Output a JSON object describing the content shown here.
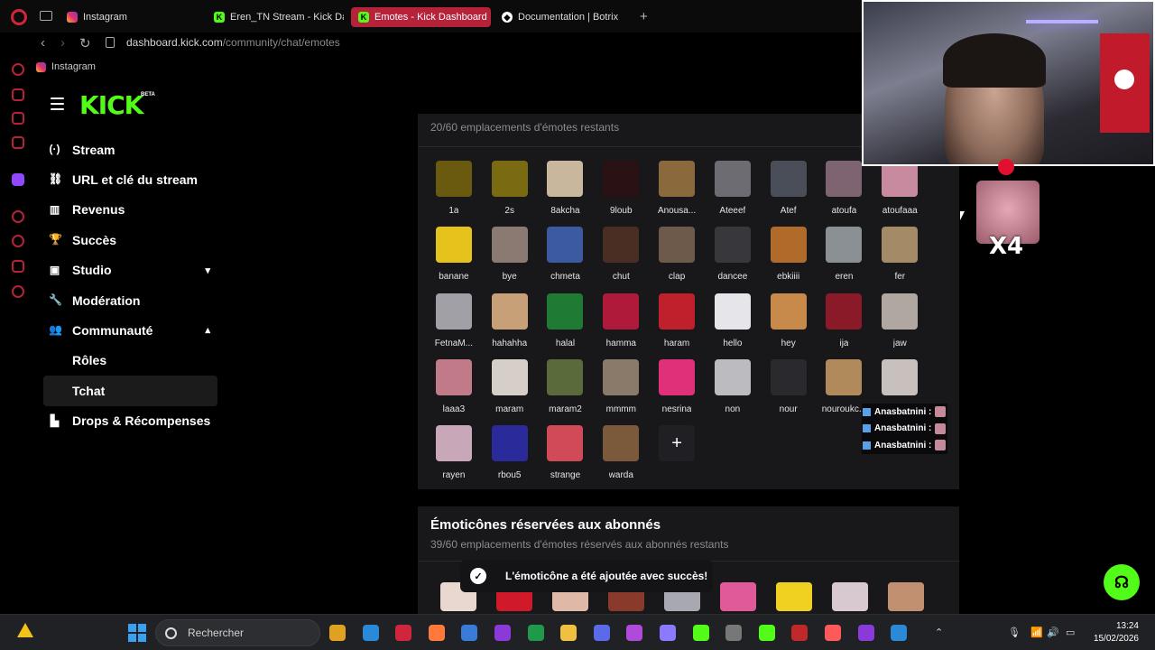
{
  "browser": {
    "tabs": [
      {
        "label": "Instagram",
        "icon": "instagram-icon",
        "fav": "insta"
      },
      {
        "label": "Eren_TN Stream - Kick Da",
        "icon": "kick-icon",
        "fav": "kick"
      },
      {
        "label": "Emotes - Kick Dashboard",
        "icon": "kick-icon",
        "fav": "kick",
        "active": true
      },
      {
        "label": "Documentation | Botrix",
        "icon": "botrix-icon",
        "fav": "botrix"
      }
    ],
    "url_host": "dashboard.kick.com",
    "url_path": "/community/chat/emotes",
    "bookmark": "Instagram"
  },
  "app": {
    "logo": "KICK",
    "beta": "BETA",
    "nav": [
      {
        "label": "Stream",
        "icon": "broadcast-icon",
        "glyph": "(·)"
      },
      {
        "label": "URL et clé du stream",
        "icon": "link-icon",
        "glyph": "⛓"
      },
      {
        "label": "Revenus",
        "icon": "chart-icon",
        "glyph": "▥"
      },
      {
        "label": "Succès",
        "icon": "trophy-icon",
        "glyph": "🏆"
      },
      {
        "label": "Studio",
        "icon": "studio-icon",
        "glyph": "▣",
        "chevron": "▾"
      },
      {
        "label": "Modération",
        "icon": "wrench-icon",
        "glyph": "🔧"
      },
      {
        "label": "Communauté",
        "icon": "community-icon",
        "glyph": "👥",
        "chevron": "▴"
      },
      {
        "label": "Rôles",
        "sub": true
      },
      {
        "label": "Tchat",
        "sub": true,
        "active": true
      },
      {
        "label": "Drops & Récompenses",
        "icon": "drops-icon",
        "glyph": "▙"
      }
    ]
  },
  "emotes": {
    "slots_text": "20/60 emplacements d'émotes restants",
    "items": [
      {
        "name": "1a",
        "color": "#6a5a10"
      },
      {
        "name": "2s",
        "color": "#7a6a12"
      },
      {
        "name": "8akcha",
        "color": "#c9b79d"
      },
      {
        "name": "9loub",
        "color": "#2a1214"
      },
      {
        "name": "Anousa...",
        "color": "#8a6a3c"
      },
      {
        "name": "Ateeef",
        "color": "#6c6c72"
      },
      {
        "name": "Atef",
        "color": "#4a4e58"
      },
      {
        "name": "atoufa",
        "color": "#7d6470"
      },
      {
        "name": "atoufaaa",
        "color": "#c78a9f"
      },
      {
        "name": "banane",
        "color": "#e6c21c"
      },
      {
        "name": "bye",
        "color": "#8a7a72"
      },
      {
        "name": "chmeta",
        "color": "#3c5aa0"
      },
      {
        "name": "chut",
        "color": "#4a2e24"
      },
      {
        "name": "clap",
        "color": "#6e5a4a"
      },
      {
        "name": "dancee",
        "color": "#38383c"
      },
      {
        "name": "ebkiiii",
        "color": "#b06a2a"
      },
      {
        "name": "eren",
        "color": "#8a9094"
      },
      {
        "name": "fer",
        "color": "#a58a68"
      },
      {
        "name": "FetnaM...",
        "color": "#a0a0a6"
      },
      {
        "name": "hahahha",
        "color": "#c7a078"
      },
      {
        "name": "halal",
        "color": "#1f7a34"
      },
      {
        "name": "hamma",
        "color": "#b01a3a"
      },
      {
        "name": "haram",
        "color": "#c0202c"
      },
      {
        "name": "hello",
        "color": "#e6e6ea"
      },
      {
        "name": "hey",
        "color": "#c78a4a"
      },
      {
        "name": "ija",
        "color": "#8a1a28"
      },
      {
        "name": "jaw",
        "color": "#b0a8a0"
      },
      {
        "name": "laaa3",
        "color": "#c07a88"
      },
      {
        "name": "maram",
        "color": "#d6cfc8"
      },
      {
        "name": "maram2",
        "color": "#5a6a3a"
      },
      {
        "name": "mmmm",
        "color": "#8a7a6a"
      },
      {
        "name": "nesrina",
        "color": "#e0307a"
      },
      {
        "name": "non",
        "color": "#bcbcc0"
      },
      {
        "name": "nour",
        "color": "#2a2a2e"
      },
      {
        "name": "nouroukc...",
        "color": "#b08a5a"
      },
      {
        "name": "...",
        "color": "#c8c0bc"
      },
      {
        "name": "rayen",
        "color": "#c8a8b8"
      },
      {
        "name": "rbou5",
        "color": "#2a2a9a"
      },
      {
        "name": "strange",
        "color": "#d04a58"
      },
      {
        "name": "warda",
        "color": "#7a5a3a"
      }
    ]
  },
  "subs": {
    "title": "Émoticônes réservées aux abonnés",
    "slots_text": "39/60 emplacements d'émotes réservés aux abonnés restants",
    "preview_colors": [
      "#e8d8d0",
      "#d01a2a",
      "#e0b8a8",
      "#8a3a2a",
      "#a8a8b0",
      "#e05a9a",
      "#f0d020",
      "#d8c8d0",
      "#c09070"
    ]
  },
  "toast": "L'émoticône a été ajoutée avec succès!",
  "overlay": {
    "multiplier": "X4",
    "chat": [
      "Anasbatnini :",
      "Anasbatnini :",
      "Anasbatnini :"
    ]
  },
  "taskbar": {
    "search_placeholder": "Rechercher",
    "time": "13:24",
    "date": "15/02/2026",
    "apps": [
      "#e0a020",
      "#2a8ad8",
      "#d0263d",
      "#ff7a3a",
      "#3a7ad8",
      "#8a3ad8",
      "#1f9a4a",
      "#f0c040",
      "#5a6ae8",
      "#b04ad8",
      "#8a7aff",
      "#53fc18",
      "#777",
      "#53fc18",
      "#c0282a",
      "#ff5a5a",
      "#8a3ad8",
      "#2a8ad8"
    ]
  }
}
